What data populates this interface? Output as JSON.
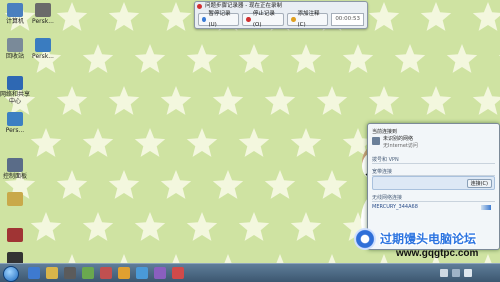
{
  "desktop": {
    "icons": [
      {
        "label": "计算机",
        "color": "#4a7fbf"
      },
      {
        "label": "Persk...",
        "color": "#6a6a6a"
      },
      {
        "label": "回收站",
        "color": "#7a8a99"
      },
      {
        "label": "Persk...",
        "color": "#3a7cc0"
      },
      {
        "label": "网络和共享中心",
        "color": "#2e68b3"
      },
      {
        "label": "Pers...",
        "color": "#3c7fc2"
      },
      {
        "label": "控制面板",
        "color": "#5a6c88"
      },
      {
        "label": "",
        "color": "#c9a94a"
      },
      {
        "label": "",
        "color": "#a03434"
      },
      {
        "label": "",
        "color": "#333333"
      }
    ]
  },
  "recorder": {
    "title": "问题步骤记录器 - 现在正在录制",
    "pause_label": "暂停记录(U)",
    "stop_label": "停止记录(O)",
    "comment_label": "添加注释(C)",
    "timer": "00:00:53"
  },
  "network_popup": {
    "current_label": "当前连接到",
    "network_name": "未识别的网络",
    "network_sub": "无Internet访问",
    "section_vpn": "拨号和 VPN",
    "section_broadband": "宽带连接",
    "connect_button": "连接(C)",
    "section_wireless": "无线网络连接",
    "wifi_name": "MERCURY_344A68"
  },
  "watermark": {
    "text": "过期馒头电脑论坛",
    "url": "www.gqgtpc.com"
  },
  "colors": {
    "background": "#cfe3a2",
    "star": "#f3f7de",
    "taskbar": "#4c6882"
  }
}
